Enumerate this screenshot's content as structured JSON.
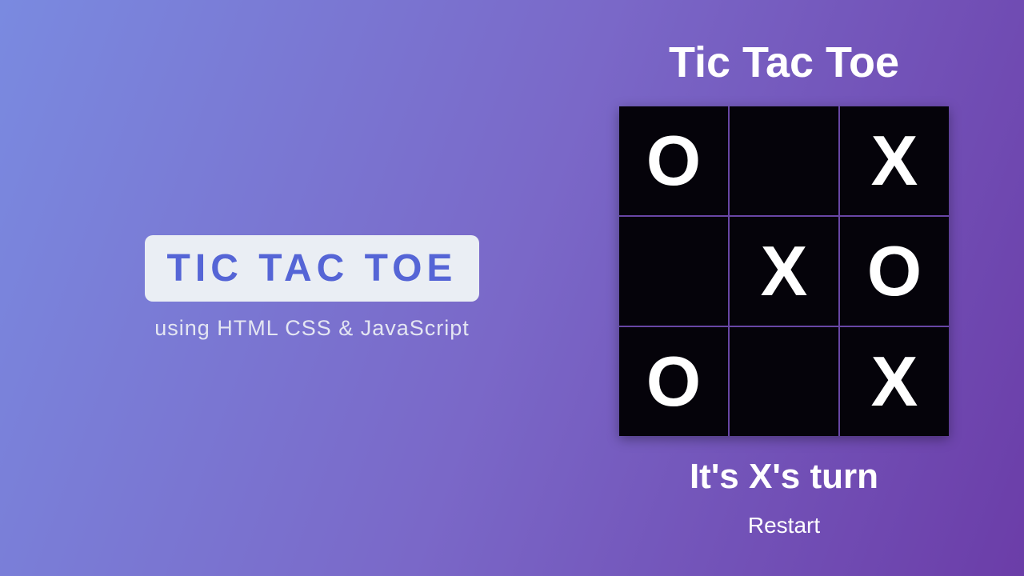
{
  "left": {
    "badge": "TIC TAC TOE",
    "subtitle": "using HTML CSS & JavaScript"
  },
  "game": {
    "title": "Tic Tac Toe",
    "status": "It's X's turn",
    "restart": "Restart",
    "current_turn": "X",
    "board": [
      "O",
      "",
      "X",
      "",
      "X",
      "O",
      "O",
      "",
      "X"
    ]
  }
}
